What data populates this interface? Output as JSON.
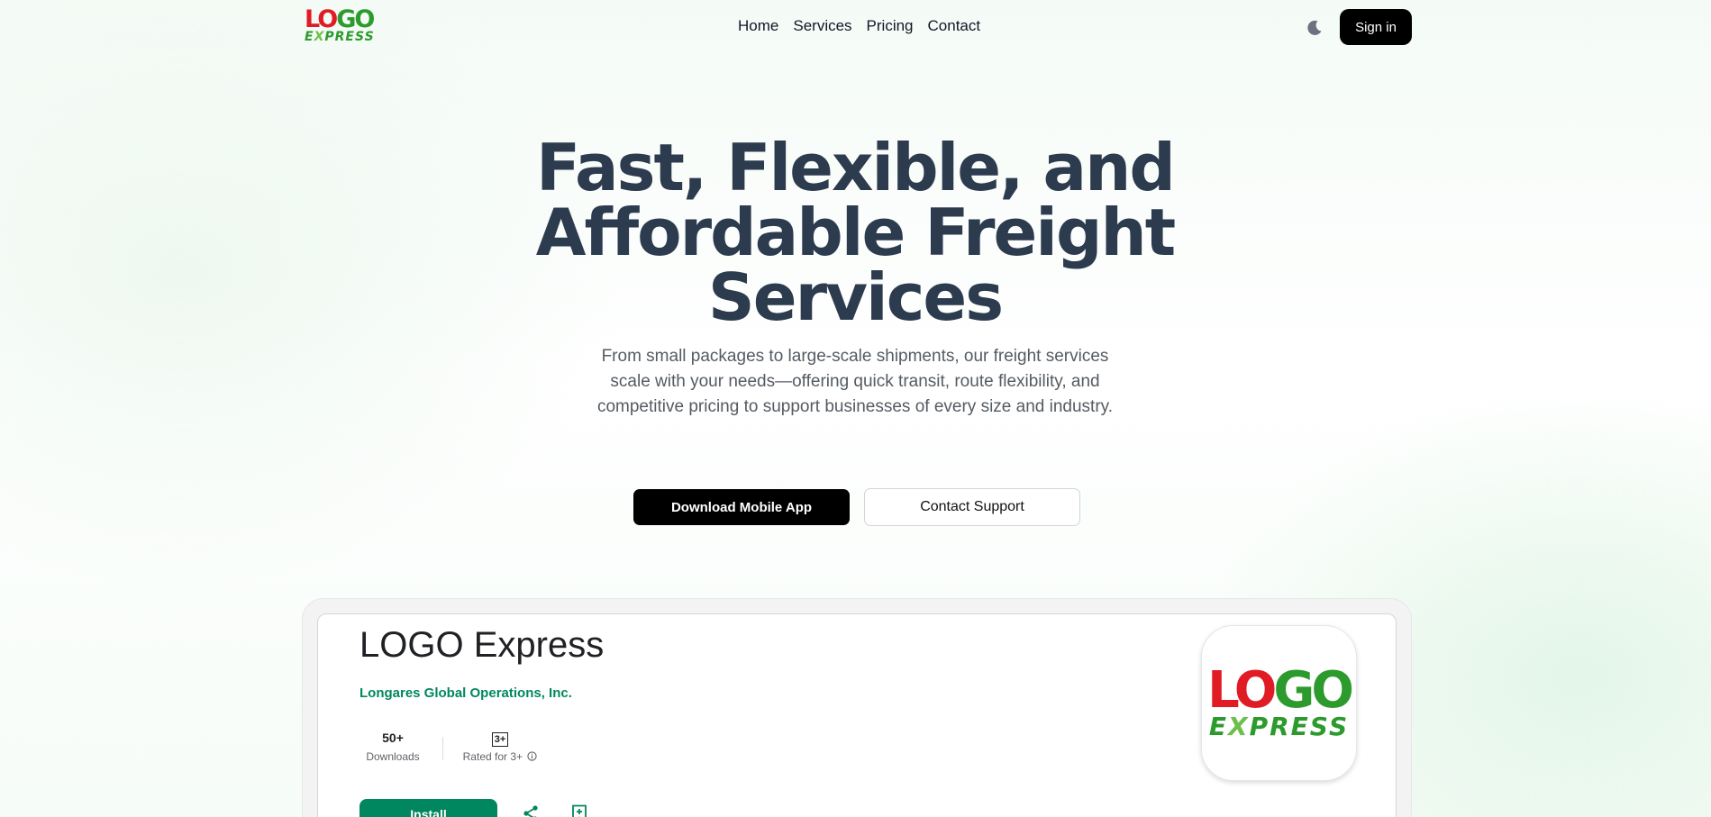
{
  "header": {
    "logo_top_left": "LO",
    "logo_top_right": "GO",
    "logo_bottom_e": "E",
    "logo_bottom_x": "X",
    "logo_bottom_rest": "PRESS",
    "nav": [
      "Home",
      "Services",
      "Pricing",
      "Contact"
    ],
    "theme_icon": "moon-icon",
    "signin_label": "Sign in"
  },
  "hero": {
    "title_line1": "Fast, Flexible, and",
    "title_line2": "Affordable Freight",
    "title_line3": "Services",
    "subtitle": "From small packages to large-scale shipments, our freight services scale with your needs—offering quick transit, route flexibility, and competitive pricing to support businesses of every size and industry.",
    "download_label": "Download Mobile App",
    "support_label": "Contact Support"
  },
  "app_card": {
    "name": "LOGO Express",
    "developer": "Longares Global Operations, Inc.",
    "downloads_value": "50+",
    "downloads_label": "Downloads",
    "rating_badge": "3+",
    "rating_label": "Rated for 3+",
    "install_label": "Install",
    "share_icon": "share-icon",
    "wishlist_icon": "wishlist-add-icon"
  },
  "colors": {
    "logo_red": "#e01b24",
    "logo_green": "#2c9a2c",
    "title": "#2d3b4f",
    "install_green": "#01875f"
  }
}
